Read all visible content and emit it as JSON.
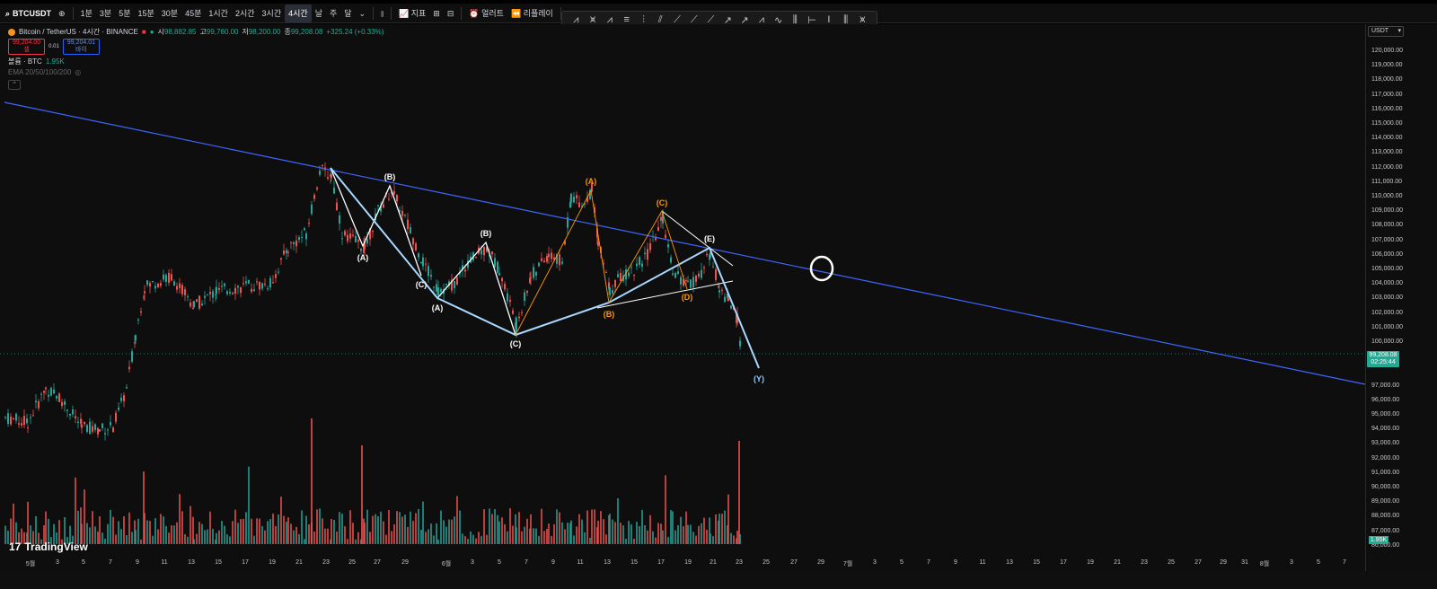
{
  "toolbar": {
    "symbol": "BTCUSDT",
    "intervals": [
      "1분",
      "3분",
      "5분",
      "15분",
      "30분",
      "45분",
      "1시간",
      "2시간",
      "3시간",
      "4시간",
      "날",
      "주",
      "달"
    ],
    "active_interval": "4시간",
    "indicators_label": "지표",
    "alert_label": "얼러트",
    "replay_label": "리플레이"
  },
  "legend": {
    "title": "Bitcoin / TetherUS · 4시간 · BINANCE",
    "open_label": "시",
    "open": "98,882.85",
    "high_label": "고",
    "high": "99,760.00",
    "low_label": "저",
    "low": "98,200.00",
    "close_label": "종",
    "close": "99,208.08",
    "change": "+325.24 (+0.33%)",
    "sell_price": "99,204.00",
    "sell_label": "셀",
    "spread": "0.01",
    "buy_price": "99,204.01",
    "buy_label": "바이",
    "volume_label": "볼륨 · BTC",
    "volume_value": "1.95K",
    "ema_label": "EMA 20/50/100/200"
  },
  "price_axis": {
    "currency": "USDT",
    "labels": [
      "120,000.00",
      "119,000.00",
      "118,000.00",
      "117,000.00",
      "116,000.00",
      "115,000.00",
      "114,000.00",
      "113,000.00",
      "112,000.00",
      "111,000.00",
      "110,000.00",
      "109,000.00",
      "108,000.00",
      "107,000.00",
      "106,000.00",
      "105,000.00",
      "104,000.00",
      "103,000.00",
      "102,000.00",
      "101,000.00",
      "100,000.00",
      "97,000.00",
      "96,000.00",
      "95,000.00",
      "94,000.00",
      "93,000.00",
      "92,000.00",
      "91,000.00",
      "90,000.00",
      "89,000.00",
      "88,000.00",
      "87,000.00",
      "86,000.00"
    ],
    "current_price": "99,208.08",
    "countdown": "02:25:44",
    "volume_tag": "1.95K"
  },
  "time_axis": {
    "labels": [
      "5월",
      "3",
      "5",
      "7",
      "9",
      "11",
      "13",
      "15",
      "17",
      "19",
      "21",
      "23",
      "25",
      "27",
      "29",
      "6월",
      "3",
      "5",
      "7",
      "9",
      "11",
      "13",
      "15",
      "17",
      "19",
      "21",
      "23",
      "25",
      "27",
      "29",
      "7월",
      "3",
      "5",
      "7",
      "9",
      "11",
      "13",
      "15",
      "17",
      "19",
      "21",
      "23",
      "25",
      "27",
      "29",
      "31",
      "8월",
      "3",
      "5",
      "7"
    ]
  },
  "waves": {
    "white": [
      "(B)",
      "(A)",
      "(C)",
      "(A)",
      "(B)",
      "(C)",
      "(E)"
    ],
    "orange": [
      "(A)",
      "(C)",
      "(B)",
      "(D)"
    ],
    "blue": [
      "(Y)"
    ]
  },
  "logo": "TradingView",
  "colors": {
    "up": "#26a69a",
    "down": "#ef5350",
    "trendline": "#3f66ff",
    "wave_white": "#ffffff",
    "wave_orange": "#ff9800",
    "wave_blue": "#8ecbff"
  }
}
